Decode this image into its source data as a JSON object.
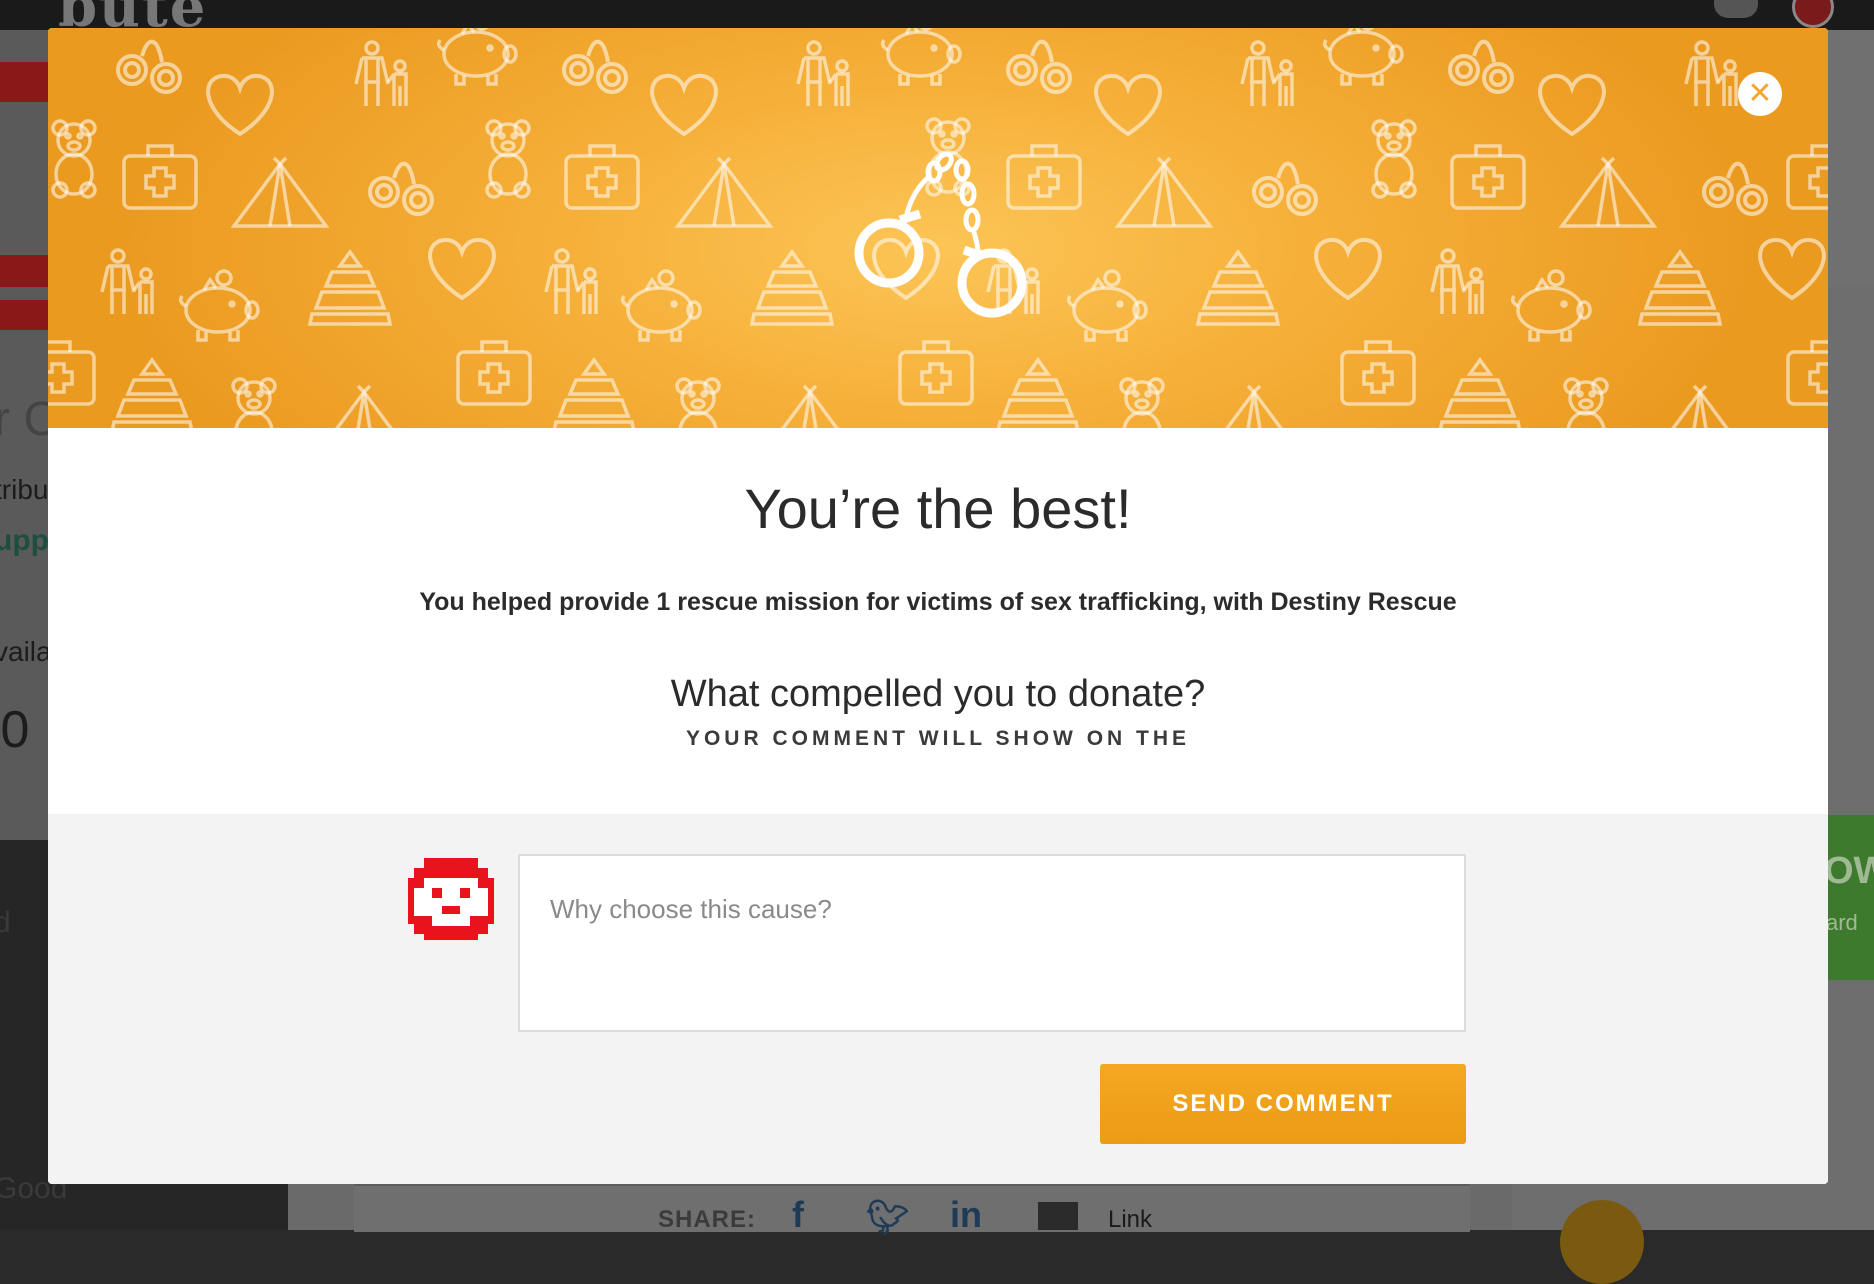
{
  "background_page": {
    "site_logo_fragment": "bute",
    "left_fragments": [
      "r C",
      "tribu",
      "upp",
      "vaila",
      ".0",
      "d",
      "Good"
    ],
    "share_label": "SHARE:",
    "share_facebook": "f",
    "share_linkedin": "in",
    "share_link_label": "Link",
    "right_button_fragment": "OW",
    "right_button_sub": "ard"
  },
  "modal": {
    "close_symbol": "✕",
    "title": "You’re the best!",
    "subtitle": "You helped provide 1 rescue mission for victims of sex trafficking, with Destiny Rescue",
    "question": "What compelled you to donate?",
    "hint": "YOUR COMMENT WILL SHOW ON THE",
    "comment_placeholder": "Why choose this cause?",
    "send_button_label": "SEND COMMENT",
    "hero_icon": "handcuffs-icon",
    "pattern_icons": [
      "handcuffs-icon",
      "family-icon",
      "piggy-bank-icon",
      "heart-icon",
      "teddy-bear-icon",
      "first-aid-kit-icon",
      "tent-icon",
      "pyramid-toy-icon"
    ]
  },
  "colors": {
    "banner_orange": "#f6b03a",
    "send_button": "#f0a21b",
    "avatar_red": "#e8131b"
  }
}
